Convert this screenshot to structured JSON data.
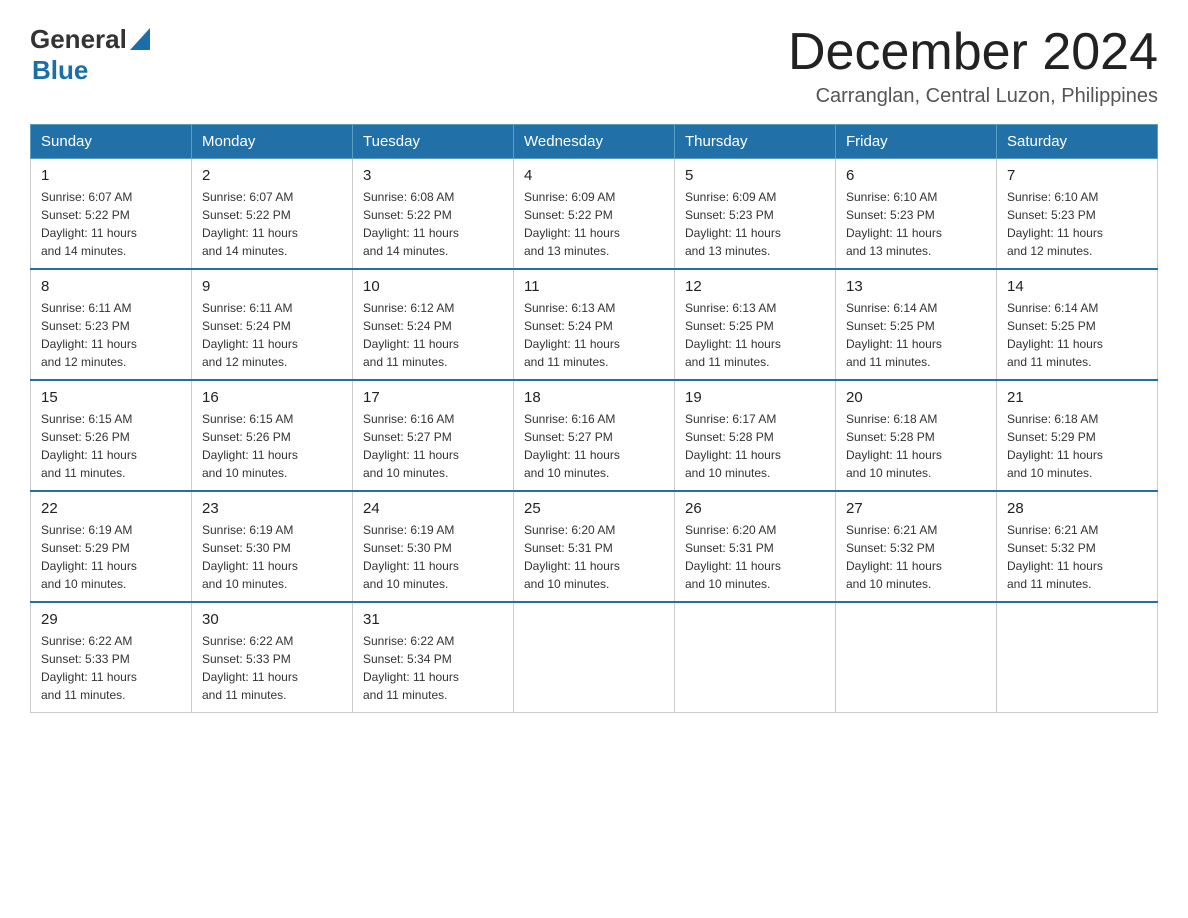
{
  "logo": {
    "text_general": "General",
    "text_blue": "Blue",
    "line1": "General",
    "line2": "Blue"
  },
  "header": {
    "month_year": "December 2024",
    "location": "Carranglan, Central Luzon, Philippines"
  },
  "weekdays": [
    "Sunday",
    "Monday",
    "Tuesday",
    "Wednesday",
    "Thursday",
    "Friday",
    "Saturday"
  ],
  "weeks": [
    [
      {
        "day": "1",
        "sunrise": "6:07 AM",
        "sunset": "5:22 PM",
        "daylight": "11 hours and 14 minutes."
      },
      {
        "day": "2",
        "sunrise": "6:07 AM",
        "sunset": "5:22 PM",
        "daylight": "11 hours and 14 minutes."
      },
      {
        "day": "3",
        "sunrise": "6:08 AM",
        "sunset": "5:22 PM",
        "daylight": "11 hours and 14 minutes."
      },
      {
        "day": "4",
        "sunrise": "6:09 AM",
        "sunset": "5:22 PM",
        "daylight": "11 hours and 13 minutes."
      },
      {
        "day": "5",
        "sunrise": "6:09 AM",
        "sunset": "5:23 PM",
        "daylight": "11 hours and 13 minutes."
      },
      {
        "day": "6",
        "sunrise": "6:10 AM",
        "sunset": "5:23 PM",
        "daylight": "11 hours and 13 minutes."
      },
      {
        "day": "7",
        "sunrise": "6:10 AM",
        "sunset": "5:23 PM",
        "daylight": "11 hours and 12 minutes."
      }
    ],
    [
      {
        "day": "8",
        "sunrise": "6:11 AM",
        "sunset": "5:23 PM",
        "daylight": "11 hours and 12 minutes."
      },
      {
        "day": "9",
        "sunrise": "6:11 AM",
        "sunset": "5:24 PM",
        "daylight": "11 hours and 12 minutes."
      },
      {
        "day": "10",
        "sunrise": "6:12 AM",
        "sunset": "5:24 PM",
        "daylight": "11 hours and 11 minutes."
      },
      {
        "day": "11",
        "sunrise": "6:13 AM",
        "sunset": "5:24 PM",
        "daylight": "11 hours and 11 minutes."
      },
      {
        "day": "12",
        "sunrise": "6:13 AM",
        "sunset": "5:25 PM",
        "daylight": "11 hours and 11 minutes."
      },
      {
        "day": "13",
        "sunrise": "6:14 AM",
        "sunset": "5:25 PM",
        "daylight": "11 hours and 11 minutes."
      },
      {
        "day": "14",
        "sunrise": "6:14 AM",
        "sunset": "5:25 PM",
        "daylight": "11 hours and 11 minutes."
      }
    ],
    [
      {
        "day": "15",
        "sunrise": "6:15 AM",
        "sunset": "5:26 PM",
        "daylight": "11 hours and 11 minutes."
      },
      {
        "day": "16",
        "sunrise": "6:15 AM",
        "sunset": "5:26 PM",
        "daylight": "11 hours and 10 minutes."
      },
      {
        "day": "17",
        "sunrise": "6:16 AM",
        "sunset": "5:27 PM",
        "daylight": "11 hours and 10 minutes."
      },
      {
        "day": "18",
        "sunrise": "6:16 AM",
        "sunset": "5:27 PM",
        "daylight": "11 hours and 10 minutes."
      },
      {
        "day": "19",
        "sunrise": "6:17 AM",
        "sunset": "5:28 PM",
        "daylight": "11 hours and 10 minutes."
      },
      {
        "day": "20",
        "sunrise": "6:18 AM",
        "sunset": "5:28 PM",
        "daylight": "11 hours and 10 minutes."
      },
      {
        "day": "21",
        "sunrise": "6:18 AM",
        "sunset": "5:29 PM",
        "daylight": "11 hours and 10 minutes."
      }
    ],
    [
      {
        "day": "22",
        "sunrise": "6:19 AM",
        "sunset": "5:29 PM",
        "daylight": "11 hours and 10 minutes."
      },
      {
        "day": "23",
        "sunrise": "6:19 AM",
        "sunset": "5:30 PM",
        "daylight": "11 hours and 10 minutes."
      },
      {
        "day": "24",
        "sunrise": "6:19 AM",
        "sunset": "5:30 PM",
        "daylight": "11 hours and 10 minutes."
      },
      {
        "day": "25",
        "sunrise": "6:20 AM",
        "sunset": "5:31 PM",
        "daylight": "11 hours and 10 minutes."
      },
      {
        "day": "26",
        "sunrise": "6:20 AM",
        "sunset": "5:31 PM",
        "daylight": "11 hours and 10 minutes."
      },
      {
        "day": "27",
        "sunrise": "6:21 AM",
        "sunset": "5:32 PM",
        "daylight": "11 hours and 10 minutes."
      },
      {
        "day": "28",
        "sunrise": "6:21 AM",
        "sunset": "5:32 PM",
        "daylight": "11 hours and 11 minutes."
      }
    ],
    [
      {
        "day": "29",
        "sunrise": "6:22 AM",
        "sunset": "5:33 PM",
        "daylight": "11 hours and 11 minutes."
      },
      {
        "day": "30",
        "sunrise": "6:22 AM",
        "sunset": "5:33 PM",
        "daylight": "11 hours and 11 minutes."
      },
      {
        "day": "31",
        "sunrise": "6:22 AM",
        "sunset": "5:34 PM",
        "daylight": "11 hours and 11 minutes."
      },
      null,
      null,
      null,
      null
    ]
  ]
}
